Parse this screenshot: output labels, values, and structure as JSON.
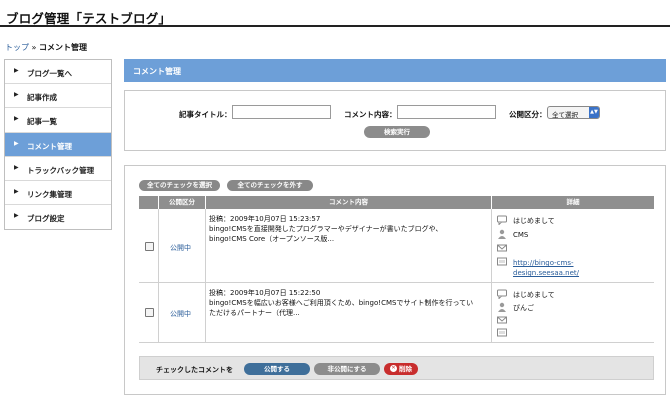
{
  "page": {
    "title": "ブログ管理「テストブログ」"
  },
  "breadcrumb": {
    "top": "トップ",
    "sep": "»",
    "current": "コメント管理"
  },
  "sidebar": {
    "items": [
      {
        "label": "ブログ一覧へ",
        "active": false
      },
      {
        "label": "記事作成",
        "active": false
      },
      {
        "label": "記事一覧",
        "active": false
      },
      {
        "label": "コメント管理",
        "active": true
      },
      {
        "label": "トラックバック管理",
        "active": false
      },
      {
        "label": "リンク集管理",
        "active": false
      },
      {
        "label": "ブログ設定",
        "active": false
      }
    ]
  },
  "header": {
    "title": "コメント管理"
  },
  "search": {
    "article_title_label": "記事タイトル：",
    "article_title_value": "",
    "comment_label": "コメント内容：",
    "comment_value": "",
    "visibility_label": "公開区分：",
    "visibility_selected": "全て選択",
    "submit_label": "検索実行"
  },
  "list": {
    "select_all_label": "全てのチェックを選択",
    "deselect_all_label": "全てのチェックを外す",
    "headers": {
      "status": "公開区分",
      "content": "コメント内容",
      "detail": "詳細"
    },
    "rows": [
      {
        "status": "公開中",
        "posted": "投稿：2009年10月07日 15:23:57",
        "line1": "bingo!CMSを直接開発したプログラマーやデザイナーが書いたブログや、",
        "line2": "bingo!CMS Core（オープンソース版...",
        "line3": "",
        "title": "はじめまして",
        "author": "CMS",
        "url_line1": "http://bingo-cms-",
        "url_line2": "design.seesaa.net/"
      },
      {
        "status": "公開中",
        "posted": "投稿：2009年10月07日 15:22:50",
        "line1": "bingo!CMSを幅広いお客様へご利用頂くため、bingo!CMSでサイト制作を行ってい",
        "line2": "ただけるパートナー（代理...",
        "line3": "",
        "title": "はじめまして",
        "author": "ぴんご",
        "url_line1": "",
        "url_line2": ""
      }
    ],
    "bulk": {
      "label": "チェックしたコメントを",
      "publish": "公開する",
      "unpublish": "非公開にする",
      "delete": "削除"
    }
  },
  "icons": {
    "arrow": "triangle-right-icon",
    "title": "speech-bubble-icon",
    "user": "user-icon",
    "mail": "mail-icon",
    "url": "link-icon"
  },
  "colors": {
    "accent": "#6d9fd8",
    "link": "#2a5d9a",
    "button_gray": "#888888",
    "publish": "#3f6f9a",
    "delete": "#c82d2d"
  }
}
